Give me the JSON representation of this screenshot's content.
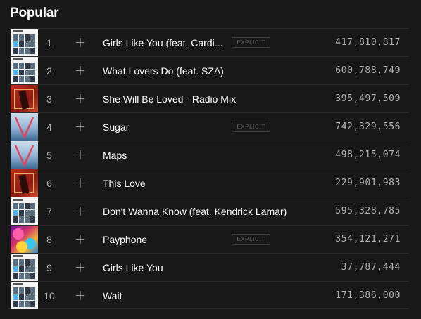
{
  "section": {
    "title": "Popular"
  },
  "explicit_label": "EXPLICIT",
  "tracks": [
    {
      "num": "1",
      "name": "Girls Like You (feat. Cardi...",
      "explicit": true,
      "plays": "417,810,817",
      "art": "white"
    },
    {
      "num": "2",
      "name": "What Lovers Do (feat. SZA)",
      "explicit": false,
      "plays": "600,788,749",
      "art": "white"
    },
    {
      "num": "3",
      "name": "She Will Be Loved - Radio Mix",
      "explicit": false,
      "plays": "395,497,509",
      "art": "red"
    },
    {
      "num": "4",
      "name": "Sugar",
      "explicit": true,
      "plays": "742,329,556",
      "art": "v"
    },
    {
      "num": "5",
      "name": "Maps",
      "explicit": false,
      "plays": "498,215,074",
      "art": "v"
    },
    {
      "num": "6",
      "name": "This Love",
      "explicit": false,
      "plays": "229,901,983",
      "art": "red"
    },
    {
      "num": "7",
      "name": "Don't Wanna Know (feat. Kendrick Lamar)",
      "explicit": false,
      "plays": "595,328,785",
      "art": "white"
    },
    {
      "num": "8",
      "name": "Payphone",
      "explicit": true,
      "plays": "354,121,271",
      "art": "pay"
    },
    {
      "num": "9",
      "name": "Girls Like You",
      "explicit": false,
      "plays": "37,787,444",
      "art": "white"
    },
    {
      "num": "10",
      "name": "Wait",
      "explicit": false,
      "plays": "171,386,000",
      "art": "white"
    }
  ],
  "icons": {
    "add": "plus-icon"
  },
  "colors": {
    "background": "#181818",
    "text": "#ffffff",
    "muted": "#b3b3b3",
    "divider": "#2a2a2a"
  }
}
